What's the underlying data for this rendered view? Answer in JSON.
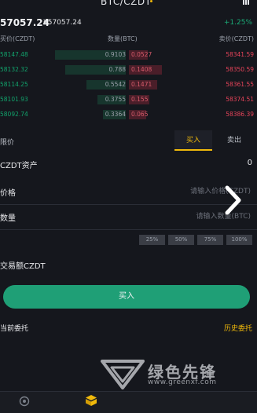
{
  "header": {
    "pair": "BTC/CZDT",
    "last_price": "57057.24",
    "cny_price": "¥57057.24",
    "change": "+1.25%"
  },
  "orderbook": {
    "col_bid_price": "买价(CZDT)",
    "col_qty": "数量(BTC)",
    "col_ask_price": "卖价(CZDT)",
    "rows": [
      {
        "bid_price": "58147.48",
        "bid_qty": "0.9103",
        "ask_qty": "0.0527",
        "ask_price": "58341.59",
        "bid_fill": 0.75,
        "ask_fill": 0.2
      },
      {
        "bid_price": "58132.32",
        "bid_qty": "0.788",
        "ask_qty": "0.1408",
        "ask_price": "58350.59",
        "bid_fill": 0.64,
        "ask_fill": 0.35
      },
      {
        "bid_price": "58114.25",
        "bid_qty": "0.5542",
        "ask_qty": "0.1471",
        "ask_price": "58361.55",
        "bid_fill": 0.42,
        "ask_fill": 0.3
      },
      {
        "bid_price": "58101.93",
        "bid_qty": "0.3755",
        "ask_qty": "0.155",
        "ask_price": "58374.51",
        "bid_fill": 0.3,
        "ask_fill": 0.22
      },
      {
        "bid_price": "58092.74",
        "bid_qty": "0.3364",
        "ask_qty": "0.065",
        "ask_price": "58386.39",
        "bid_fill": 0.24,
        "ask_fill": 0.18
      }
    ]
  },
  "trade": {
    "left_label": "限价",
    "tab_buy": "买入",
    "tab_sell": "卖出",
    "asset_label": "CZDT资产",
    "asset_value": "0",
    "price_label": "价格",
    "price_placeholder": "请输入价格(CZDT)",
    "qty_label": "数量",
    "qty_placeholder": "请输入数量(BTC)",
    "percents": [
      "25%",
      "50%",
      "75%",
      "100%"
    ],
    "total_label": "交易额CZDT",
    "buy_button": "买入"
  },
  "orders": {
    "label": "当前委托",
    "history": "历史委托"
  },
  "watermark": {
    "text": "绿色先锋",
    "url": "www.greenxf.com"
  },
  "colors": {
    "background": "#15171d",
    "buy_green": "#1f9f76",
    "sell_red": "#e8445a",
    "accent_gold": "#f0b90b"
  },
  "icons": {
    "menu": "menu-icon",
    "arrow": "chevron-right-icon",
    "home": "home-icon",
    "trade": "trade-icon",
    "logo": "watermark-logo"
  }
}
